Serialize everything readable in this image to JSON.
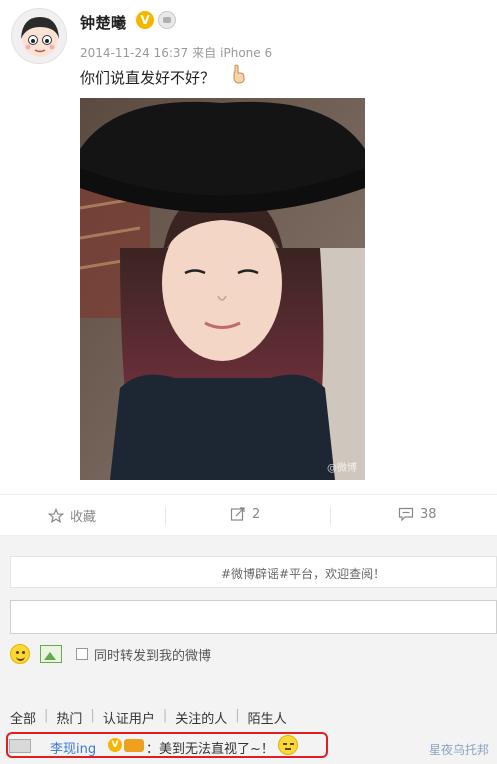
{
  "post": {
    "username": "钟楚曦",
    "verified_badge": "V",
    "timestamp": "2014-11-24 16:37",
    "source_prefix": "来自",
    "source": "iPhone 6",
    "text": "你们说直发好不好？",
    "photo_watermark": "@微博"
  },
  "actions": {
    "favorite_label": "收藏",
    "repost_count": "2",
    "comment_count": "38"
  },
  "comments": {
    "notice": "#微博辟谣#平台，欢迎查阅！",
    "input_placeholder": "",
    "repost_checkbox_label": "同时转发到我的微博",
    "filters": [
      "全部",
      "热门",
      "认证用户",
      "关注的人",
      "陌生人"
    ],
    "filter_separator": "|",
    "top_comment": {
      "author": "李现ing",
      "verified_badge": "V",
      "text": "：美到无法直视了~！"
    }
  },
  "watermark": "星夜乌托邦",
  "colors": {
    "accent_blue": "#3a7bd5",
    "verified_gold": "#f7b500",
    "highlight_red": "#e02020"
  },
  "icons": [
    "star-icon",
    "repost-icon",
    "comment-icon",
    "smiley-icon",
    "image-icon",
    "hand-emoji-icon",
    "verified-icon",
    "member-icon"
  ]
}
